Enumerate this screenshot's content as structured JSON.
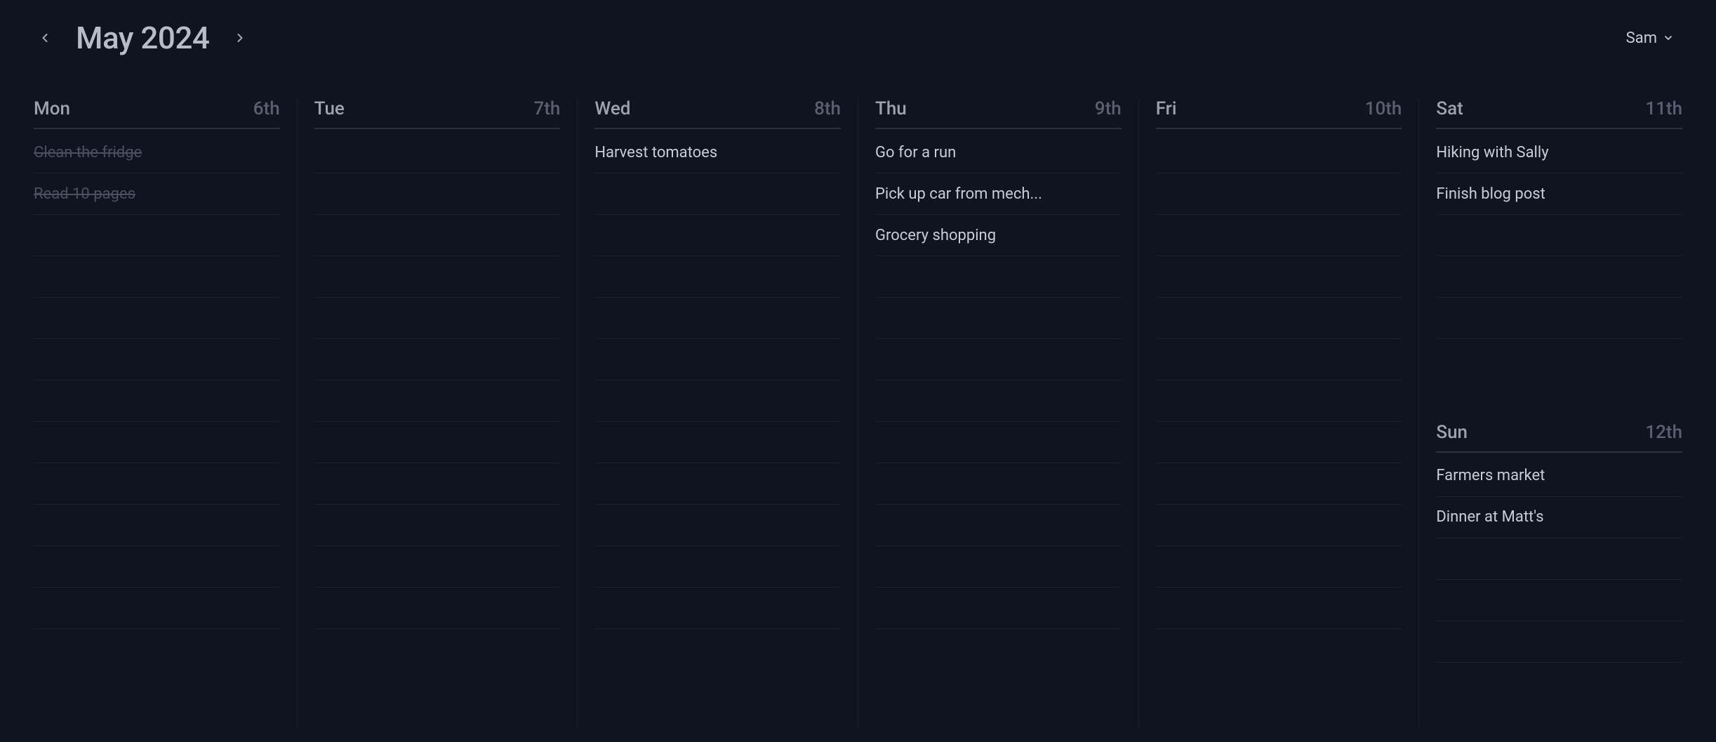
{
  "header": {
    "title": "May 2024",
    "user": "Sam"
  },
  "days": [
    {
      "name": "Mon",
      "date": "6th",
      "tasks": [
        {
          "label": "Clean the fridge",
          "done": true
        },
        {
          "label": "Read 10 pages",
          "done": true
        }
      ],
      "slots": 12
    },
    {
      "name": "Tue",
      "date": "7th",
      "tasks": [],
      "slots": 12
    },
    {
      "name": "Wed",
      "date": "8th",
      "tasks": [
        {
          "label": "Harvest tomatoes",
          "done": false
        }
      ],
      "slots": 12
    },
    {
      "name": "Thu",
      "date": "9th",
      "tasks": [
        {
          "label": "Go for a run",
          "done": false
        },
        {
          "label": "Pick up car from mech...",
          "done": false
        },
        {
          "label": "Grocery shopping",
          "done": false
        }
      ],
      "slots": 12
    },
    {
      "name": "Fri",
      "date": "10th",
      "tasks": [],
      "slots": 12
    }
  ],
  "weekend": [
    {
      "name": "Sat",
      "date": "11th",
      "tasks": [
        {
          "label": "Hiking with Sally",
          "done": false
        },
        {
          "label": "Finish blog post",
          "done": false
        }
      ],
      "slots": 5
    },
    {
      "name": "Sun",
      "date": "12th",
      "tasks": [
        {
          "label": "Farmers market",
          "done": false
        },
        {
          "label": "Dinner at Matt's",
          "done": false
        }
      ],
      "slots": 5
    }
  ]
}
